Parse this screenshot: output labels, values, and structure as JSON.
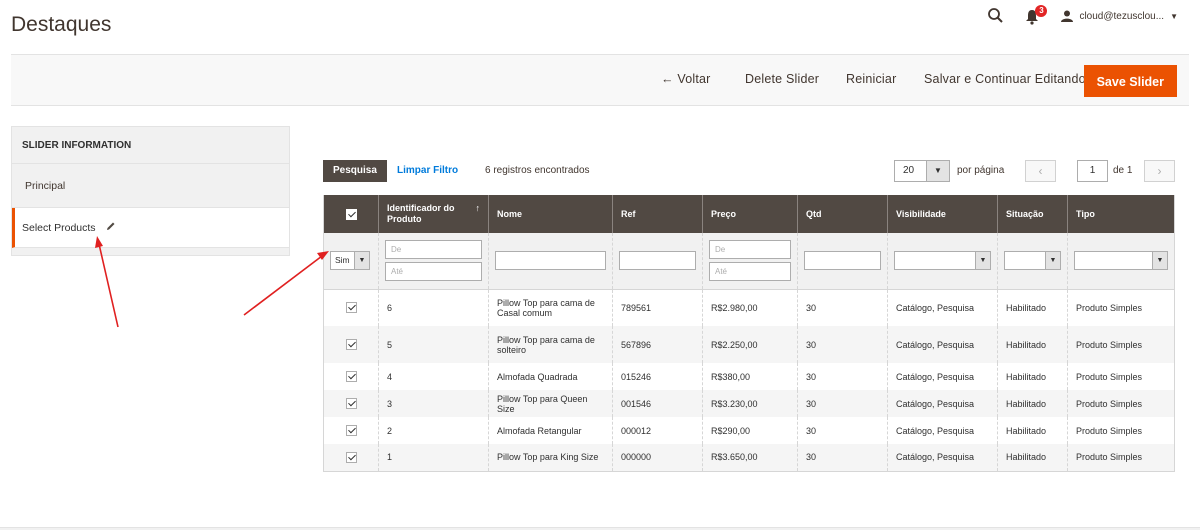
{
  "page": {
    "title": "Destaques"
  },
  "header": {
    "notifications_count": "3",
    "user": "cloud@tezusclou..."
  },
  "actions": {
    "back": "← Voltar",
    "delete": "Delete Slider",
    "reset": "Reiniciar",
    "save_continue": "Salvar e Continuar Editando",
    "save": "Save Slider"
  },
  "sidebar": {
    "header": "SLIDER INFORMATION",
    "items": [
      {
        "label": "Principal"
      },
      {
        "label": "Select Products"
      }
    ]
  },
  "grid_toolbar": {
    "search": "Pesquisa",
    "reset_filter": "Limpar Filtro",
    "records": "6 registros encontrados",
    "per_page": "20",
    "per_page_label": "por página",
    "page": "1",
    "of": "de 1"
  },
  "table": {
    "columns": [
      "Identificador do Produto",
      "Nome",
      "Ref",
      "Preço",
      "Qtd",
      "Visibilidade",
      "Situação",
      "Tipo"
    ],
    "filters": {
      "select_sim": "Sim",
      "from": "De",
      "to": "Até"
    },
    "rows": [
      {
        "id": "6",
        "nome": "Pillow Top para cama de Casal comum",
        "ref": "789561",
        "preco": "R$2.980,00",
        "qtd": "30",
        "vis": "Catálogo, Pesquisa",
        "sit": "Habilitado",
        "tipo": "Produto Simples"
      },
      {
        "id": "5",
        "nome": "Pillow Top para cama de solteiro",
        "ref": "567896",
        "preco": "R$2.250,00",
        "qtd": "30",
        "vis": "Catálogo, Pesquisa",
        "sit": "Habilitado",
        "tipo": "Produto Simples"
      },
      {
        "id": "4",
        "nome": "Almofada Quadrada",
        "ref": "015246",
        "preco": "R$380,00",
        "qtd": "30",
        "vis": "Catálogo, Pesquisa",
        "sit": "Habilitado",
        "tipo": "Produto Simples"
      },
      {
        "id": "3",
        "nome": "Pillow Top para Queen Size",
        "ref": "001546",
        "preco": "R$3.230,00",
        "qtd": "30",
        "vis": "Catálogo, Pesquisa",
        "sit": "Habilitado",
        "tipo": "Produto Simples"
      },
      {
        "id": "2",
        "nome": "Almofada Retangular",
        "ref": "000012",
        "preco": "R$290,00",
        "qtd": "30",
        "vis": "Catálogo, Pesquisa",
        "sit": "Habilitado",
        "tipo": "Produto Simples"
      },
      {
        "id": "1",
        "nome": "Pillow Top para King Size",
        "ref": "000000",
        "preco": "R$3.650,00",
        "qtd": "30",
        "vis": "Catálogo, Pesquisa",
        "sit": "Habilitado",
        "tipo": "Produto Simples"
      }
    ]
  },
  "colors": {
    "accent": "#eb5202",
    "header_bg": "#514943",
    "link": "#007bdb",
    "annotation": "#e02020"
  }
}
